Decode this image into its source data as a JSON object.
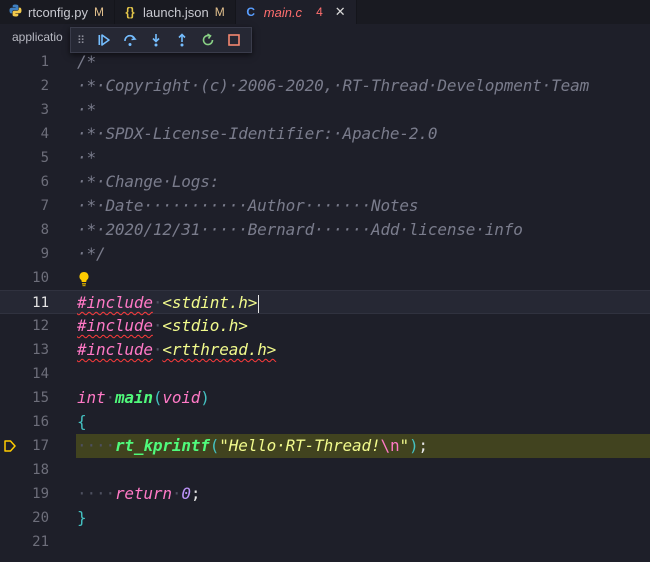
{
  "tabs": [
    {
      "name": "rtconfig.py",
      "badge": "M",
      "icon": "python-icon"
    },
    {
      "name": "launch.json",
      "badge": "M",
      "icon": "json-icon"
    },
    {
      "name": "main.c",
      "badge": "4",
      "icon": "c-file-icon",
      "active": true
    }
  ],
  "breadcrumb": "applicatio",
  "debug_toolbar": [
    "drag-handle",
    "continue",
    "step-over",
    "step-into",
    "step-out",
    "restart",
    "stop"
  ],
  "editor": {
    "current_line": 11,
    "stopped_line": 17,
    "lines": [
      {
        "n": "1",
        "t": "/*"
      },
      {
        "n": "2",
        "t": " * Copyright (c) 2006-2020, RT-Thread Development Team"
      },
      {
        "n": "3",
        "t": " *"
      },
      {
        "n": "4",
        "t": " * SPDX-License-Identifier: Apache-2.0"
      },
      {
        "n": "5",
        "t": " *"
      },
      {
        "n": "6",
        "t": " * Change Logs:"
      },
      {
        "n": "7",
        "t": " * Date           Author       Notes"
      },
      {
        "n": "8",
        "t": " * 2020/12/31     Bernard      Add license info"
      },
      {
        "n": "9",
        "t": " */"
      },
      {
        "n": "10",
        "t": ""
      },
      {
        "n": "11",
        "t": "#include <stdint.h>"
      },
      {
        "n": "12",
        "t": "#include <stdio.h>"
      },
      {
        "n": "13",
        "t": "#include <rtthread.h>"
      },
      {
        "n": "14",
        "t": ""
      },
      {
        "n": "15",
        "t": "int main(void)"
      },
      {
        "n": "16",
        "t": "{"
      },
      {
        "n": "17",
        "t": "    rt_kprintf(\"Hello RT-Thread!\\n\");"
      },
      {
        "n": "18",
        "t": ""
      },
      {
        "n": "19",
        "t": "    return 0;"
      },
      {
        "n": "20",
        "t": "}"
      },
      {
        "n": "21",
        "t": ""
      }
    ]
  },
  "colors": {
    "background": "#1e1f29",
    "keyword": "#ff79c6",
    "function": "#50fa7b",
    "string": "#f1fa8c",
    "comment": "#7a7c8c",
    "number": "#bd93f9",
    "debug_stop_highlight": "#41431f",
    "error_squiggle": "#ff3b3b"
  }
}
